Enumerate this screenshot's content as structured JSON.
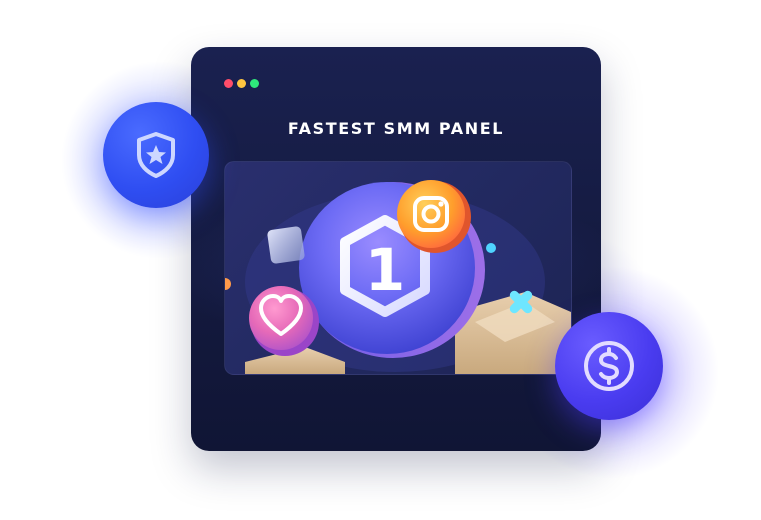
{
  "window": {
    "title": "FASTEST SMM PANEL",
    "controls": [
      {
        "name": "close-dot",
        "color": "#ff4d6a"
      },
      {
        "name": "minimize-dot",
        "color": "#ffc640"
      },
      {
        "name": "maximize-dot",
        "color": "#2ee87b"
      }
    ]
  },
  "hero": {
    "center_badge_text": "1",
    "icons": [
      "instagram-icon",
      "heart-icon",
      "cross-icon"
    ]
  },
  "badges": {
    "left": {
      "icon": "shield-star-icon",
      "color": "#2f4ef2"
    },
    "right": {
      "icon": "dollar-icon",
      "color": "#4a3cf0"
    }
  },
  "colors": {
    "window_bg": "#161c45",
    "accent_blue": "#2f4ef2",
    "accent_violet": "#4a3cf0",
    "title": "#ffffff"
  }
}
